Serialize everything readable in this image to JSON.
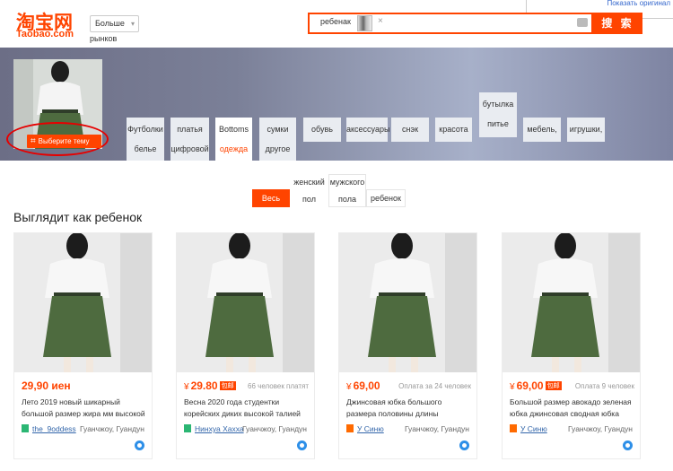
{
  "header": {
    "logo_cn": "淘宝网",
    "logo_en": "Taobao.com",
    "market_select": "Больше",
    "market_sub": "рынков",
    "search_tag": "ребенак",
    "search_button": "搜 索",
    "translate_link": "Показать оригинал"
  },
  "banner": {
    "theme_button": "Выберите тему",
    "categories": [
      {
        "top": "Футболки",
        "bottom": "белье"
      },
      {
        "top": "платья",
        "bottom": "цифровой"
      },
      {
        "top": "Bottoms",
        "bottom": "одежда"
      },
      {
        "top": "сумки",
        "bottom": "другое"
      },
      {
        "top": "обувь"
      },
      {
        "top": "аксессуары"
      },
      {
        "top": "снэк"
      },
      {
        "top": "красота"
      },
      {
        "top": "бутылка",
        "bottom": "питье"
      },
      {
        "top": "мебель,"
      },
      {
        "top": "игрушки,"
      }
    ]
  },
  "gender_filter": {
    "all": "Весь",
    "female_top": "женский",
    "female_bottom": "пол",
    "male_top": "мужского",
    "male_bottom": "пола",
    "child": "ребенок"
  },
  "section_title": "Выглядит как ребенок",
  "products": [
    {
      "currency": "",
      "price": "29,90 иен",
      "free_shipping": "",
      "paid": "",
      "title": "Лето 2019 новый шикарный большой размер жира мм высокой",
      "shop": "the_9oddess",
      "location": "Гуанчжоу, Гуандун",
      "shop_icon_color": "#2bb673"
    },
    {
      "currency": "¥",
      "price": "29.80",
      "free_shipping": "包邮",
      "paid": "66 человек платят",
      "title": "Весна 2020 года студентки корейских диких высокой талией",
      "shop": "Нинхуа Хахха",
      "location": "Гуанчжоу, Гуандун",
      "shop_icon_color": "#2bb673"
    },
    {
      "currency": "¥",
      "price": "69,00",
      "free_shipping": "",
      "paid": "Оплата за 24 человек",
      "title": "Джинсовая юбка большого размера половины длины женского",
      "shop": "У Синю",
      "location": "Гуанчжоу, Гуандун",
      "shop_icon_color": "#ff6a00"
    },
    {
      "currency": "¥",
      "price": "69,00",
      "free_shipping": "包邮",
      "paid": "Оплата 9 человек",
      "title": "Большой размер авокадо зеленая юбка джинсовая сводная юбка",
      "shop": "У Синю",
      "location": "Гуанчжоу, Гуандун",
      "shop_icon_color": "#ff6a00"
    }
  ],
  "colors": {
    "accent": "#ff4400",
    "link": "#3366aa",
    "skirt": "#4e6b3f"
  }
}
